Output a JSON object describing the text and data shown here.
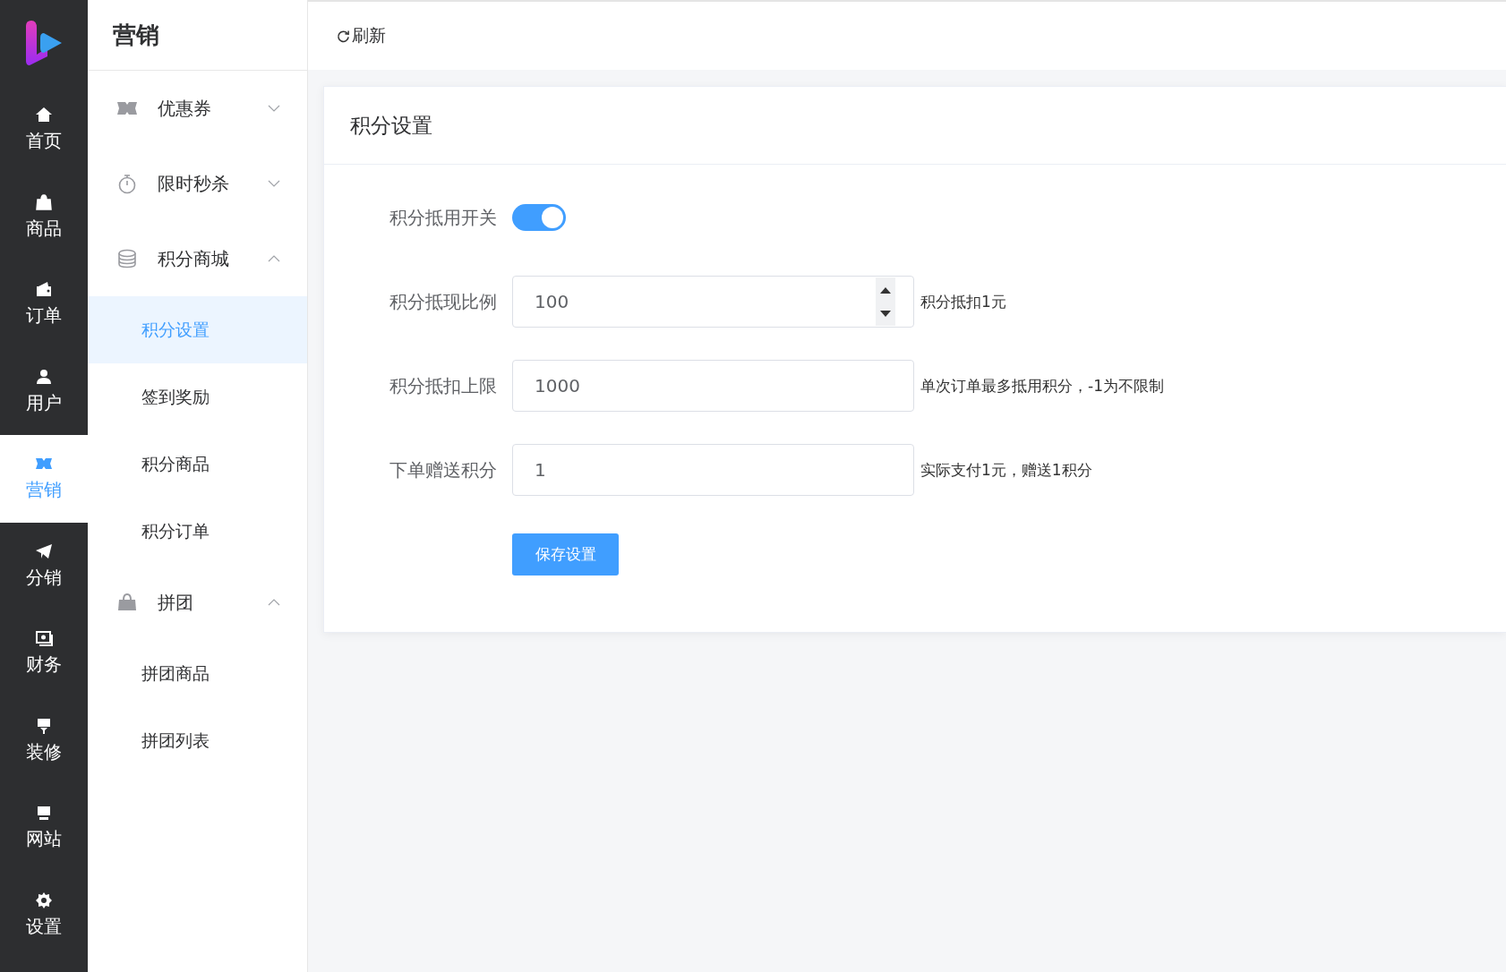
{
  "rail": {
    "items": [
      {
        "label": "首页",
        "selected": false
      },
      {
        "label": "商品",
        "selected": false
      },
      {
        "label": "订单",
        "selected": false
      },
      {
        "label": "用户",
        "selected": false
      },
      {
        "label": "营销",
        "selected": true
      },
      {
        "label": "分销",
        "selected": false
      },
      {
        "label": "财务",
        "selected": false
      },
      {
        "label": "装修",
        "selected": false
      },
      {
        "label": "网站",
        "selected": false
      },
      {
        "label": "设置",
        "selected": false
      }
    ]
  },
  "submenu": {
    "title": "营销",
    "groups": [
      {
        "label": "优惠券",
        "expanded": false
      },
      {
        "label": "限时秒杀",
        "expanded": false
      },
      {
        "label": "积分商城",
        "expanded": true,
        "children": [
          {
            "label": "积分设置",
            "selected": true
          },
          {
            "label": "签到奖励",
            "selected": false
          },
          {
            "label": "积分商品",
            "selected": false
          },
          {
            "label": "积分订单",
            "selected": false
          }
        ]
      },
      {
        "label": "拼团",
        "expanded": true,
        "children": [
          {
            "label": "拼团商品",
            "selected": false
          },
          {
            "label": "拼团列表",
            "selected": false
          }
        ]
      }
    ]
  },
  "toolbar": {
    "refresh": "刷新"
  },
  "card": {
    "title": "积分设置",
    "fields": [
      {
        "kind": "switch",
        "label": "积分抵用开关",
        "on": true
      },
      {
        "kind": "number",
        "label": "积分抵现比例",
        "value": "100",
        "hint": "积分抵扣1元"
      },
      {
        "kind": "text",
        "label": "积分抵扣上限",
        "value": "1000",
        "hint": "单次订单最多抵用积分，-1为不限制"
      },
      {
        "kind": "text",
        "label": "下单赠送积分",
        "value": "1",
        "hint": "实际支付1元，赠送1积分"
      }
    ],
    "save": "保存设置"
  }
}
